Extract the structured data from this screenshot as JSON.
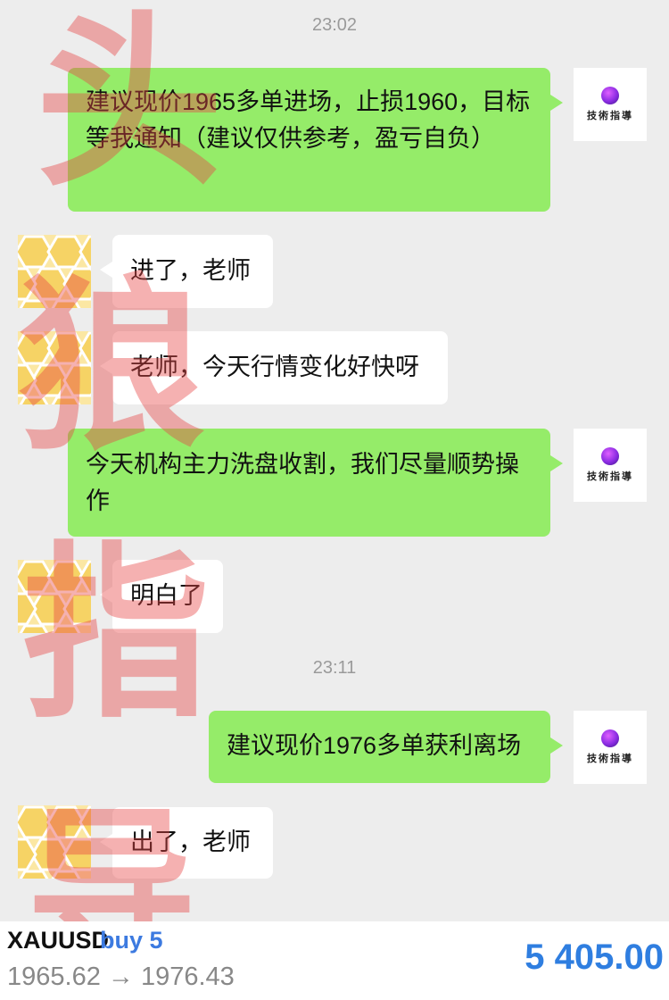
{
  "timestamps": [
    "23:02",
    "23:11"
  ],
  "brand": {
    "logo_text": "技術指導",
    "logo_icon": "purple-orb-icon"
  },
  "messages": [
    {
      "from": "advisor",
      "text": "建议现价1965多单进场，止损1960，目标等我通知（建议仅供参考，盈亏自负）"
    },
    {
      "from": "user",
      "text": "进了，老师"
    },
    {
      "from": "user",
      "text": "老师，今天行情变化好快呀"
    },
    {
      "from": "advisor",
      "text": "今天机构主力洗盘收割，我们尽量顺势操作"
    },
    {
      "from": "user",
      "text": "明白了"
    },
    {
      "from": "advisor",
      "text": "建议现价1976多单获利离场"
    },
    {
      "from": "user",
      "text": "出了，老师"
    }
  ],
  "watermark": [
    "头",
    "狼",
    "指",
    "导"
  ],
  "trade": {
    "symbol": "XAUUSD",
    "side": "buy 5",
    "prices": "1965.62 → 1976.43",
    "profit": "5 405.00"
  },
  "colors": {
    "background": "#ededed",
    "sent_bubble": "#95ec69",
    "received_bubble": "#ffffff",
    "profit": "#2f7ee0",
    "side": "#3c7ae0",
    "watermark": "#e84646"
  }
}
